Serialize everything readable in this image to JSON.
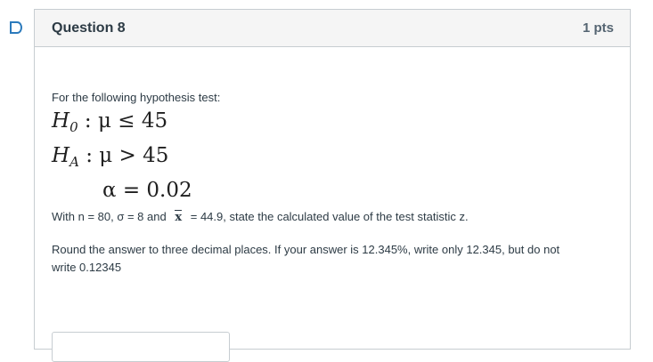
{
  "question": {
    "title": "Question 8",
    "points": "1 pts"
  },
  "content": {
    "intro": "For the following hypothesis test:",
    "h0": {
      "symbol": "H",
      "sub": "0",
      "rest": ": μ ≤ 45"
    },
    "ha": {
      "symbol": "H",
      "sub": "A",
      "rest": ": μ > 45"
    },
    "alpha": "α = 0.02",
    "given_prefix": "With n = 80, σ = 8 and",
    "xbar_symbol": "x",
    "given_suffix": "= 44.9, state the calculated value of the test statistic z.",
    "instructions": "Round the answer to three decimal places. If your answer is 12.345%, write only 12.345, but do not write 0.12345"
  },
  "answer": {
    "value": "",
    "placeholder": ""
  },
  "colors": {
    "flag": "#2b7abc",
    "header_bg": "#f5f5f5",
    "border": "#c7cdd1",
    "text": "#2d3b45"
  },
  "icons": {
    "flag": "bookmark-flag-icon"
  }
}
